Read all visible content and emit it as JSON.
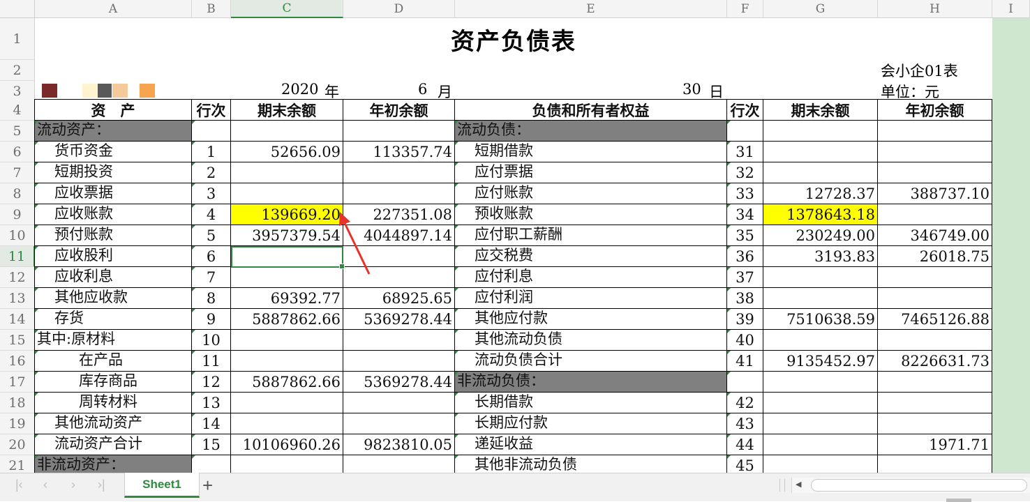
{
  "columns": [
    "A",
    "B",
    "C",
    "D",
    "E",
    "F",
    "G",
    "H",
    "I"
  ],
  "active_column": "C",
  "rows": [
    "1",
    "2",
    "3",
    "4",
    "5",
    "6",
    "7",
    "8",
    "9",
    "10",
    "11",
    "12",
    "13",
    "14",
    "15",
    "16",
    "17",
    "18",
    "19",
    "20",
    "21"
  ],
  "active_row": "11",
  "title": "资产负债表",
  "form_code": "会小企01表",
  "unit": "单位：元",
  "date": {
    "year": "2020",
    "year_unit": "年",
    "month": "6",
    "month_unit": "月",
    "day": "30",
    "day_unit": "日"
  },
  "redaction_colors": [
    "#7b2a2a",
    "#fff3d0",
    "#595959",
    "#f5c99a",
    "#f7a44f"
  ],
  "headers": {
    "assets": "资　产",
    "line_no": "行次",
    "end_balance": "期末余额",
    "begin_balance": "年初余额",
    "liabilities": "负债和所有者权益",
    "line_no_2": "行次",
    "end_balance_2": "期末余额",
    "begin_balance_2": "年初余额"
  },
  "table_rows": [
    {
      "asset": "流动资产：",
      "no": "",
      "end": "",
      "begin": "",
      "liab": "流动负债：",
      "lno": "",
      "lend": "",
      "lbegin": ""
    },
    {
      "asset": "货币资金",
      "no": "1",
      "end": "52656.09",
      "begin": "113357.74",
      "liab": "短期借款",
      "lno": "31",
      "lend": "",
      "lbegin": ""
    },
    {
      "asset": "短期投资",
      "no": "2",
      "end": "",
      "begin": "",
      "liab": "应付票据",
      "lno": "32",
      "lend": "",
      "lbegin": ""
    },
    {
      "asset": "应收票据",
      "no": "3",
      "end": "",
      "begin": "",
      "liab": "应付账款",
      "lno": "33",
      "lend": "12728.37",
      "lbegin": "388737.10"
    },
    {
      "asset": "应收账款",
      "no": "4",
      "end": "139669.20",
      "begin": "227351.08",
      "liab": "预收账款",
      "lno": "34",
      "lend": "1378643.18",
      "lbegin": ""
    },
    {
      "asset": "预付账款",
      "no": "5",
      "end": "3957379.54",
      "begin": "4044897.14",
      "liab": "应付职工薪酬",
      "lno": "35",
      "lend": "230249.00",
      "lbegin": "346749.00"
    },
    {
      "asset": "应收股利",
      "no": "6",
      "end": "",
      "begin": "",
      "liab": "应交税费",
      "lno": "36",
      "lend": "3193.83",
      "lbegin": "26018.75"
    },
    {
      "asset": "应收利息",
      "no": "7",
      "end": "",
      "begin": "",
      "liab": "应付利息",
      "lno": "37",
      "lend": "",
      "lbegin": ""
    },
    {
      "asset": "其他应收款",
      "no": "8",
      "end": "69392.77",
      "begin": "68925.65",
      "liab": "应付利润",
      "lno": "38",
      "lend": "",
      "lbegin": ""
    },
    {
      "asset": "存货",
      "no": "9",
      "end": "5887862.66",
      "begin": "5369278.44",
      "liab": "其他应付款",
      "lno": "39",
      "lend": "7510638.59",
      "lbegin": "7465126.88"
    },
    {
      "asset": "其中:原材料",
      "no": "10",
      "end": "",
      "begin": "",
      "liab": "其他流动负债",
      "lno": "40",
      "lend": "",
      "lbegin": ""
    },
    {
      "asset": "在产品",
      "no": "11",
      "end": "",
      "begin": "",
      "liab": "流动负债合计",
      "lno": "41",
      "lend": "9135452.97",
      "lbegin": "8226631.73"
    },
    {
      "asset": "库存商品",
      "no": "12",
      "end": "5887862.66",
      "begin": "5369278.44",
      "liab": "非流动负债：",
      "lno": "",
      "lend": "",
      "lbegin": ""
    },
    {
      "asset": "周转材料",
      "no": "13",
      "end": "",
      "begin": "",
      "liab": "长期借款",
      "lno": "42",
      "lend": "",
      "lbegin": ""
    },
    {
      "asset": "其他流动资产",
      "no": "14",
      "end": "",
      "begin": "",
      "liab": "长期应付款",
      "lno": "43",
      "lend": "",
      "lbegin": ""
    },
    {
      "asset": "流动资产合计",
      "no": "15",
      "end": "10106960.26",
      "begin": "9823810.05",
      "liab": "递延收益",
      "lno": "44",
      "lend": "",
      "lbegin": "1971.71"
    },
    {
      "asset": "非流动资产：",
      "no": "",
      "end": "",
      "begin": "",
      "liab": "其他非流动负债",
      "lno": "45",
      "lend": "",
      "lbegin": ""
    }
  ],
  "sheet_tab": "Sheet1",
  "add_sheet_icon": "plus-icon",
  "colors": {
    "accent": "#2d8a3e",
    "highlight": "#ffff00",
    "section_fill": "#808080",
    "annotation_arrow": "#e8312a"
  }
}
